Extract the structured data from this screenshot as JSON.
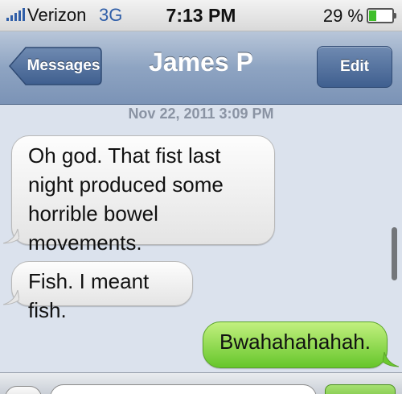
{
  "status_bar": {
    "carrier": "Verizon",
    "network": "3G",
    "time": "7:13 PM",
    "battery_percent": "29 %",
    "battery_level": 0.29,
    "signal_icon": "signal-bars-icon",
    "battery_icon": "battery-icon"
  },
  "nav": {
    "back_label": "Messages",
    "title": "James P",
    "edit_label": "Edit"
  },
  "conversation": {
    "timestamp": "Nov 22, 2011 3:09 PM",
    "messages": [
      {
        "direction": "received",
        "text": "Oh god. That fist last night produced some horrible bowel movements."
      },
      {
        "direction": "received",
        "text": "Fish. I meant fish."
      },
      {
        "direction": "sent",
        "text": "Bwahahahahah."
      }
    ]
  },
  "colors": {
    "nav_bar": "#8ea4c2",
    "sent_bubble": "#66c62b",
    "received_bubble": "#e4e4e4",
    "background": "#dbe2ed"
  }
}
